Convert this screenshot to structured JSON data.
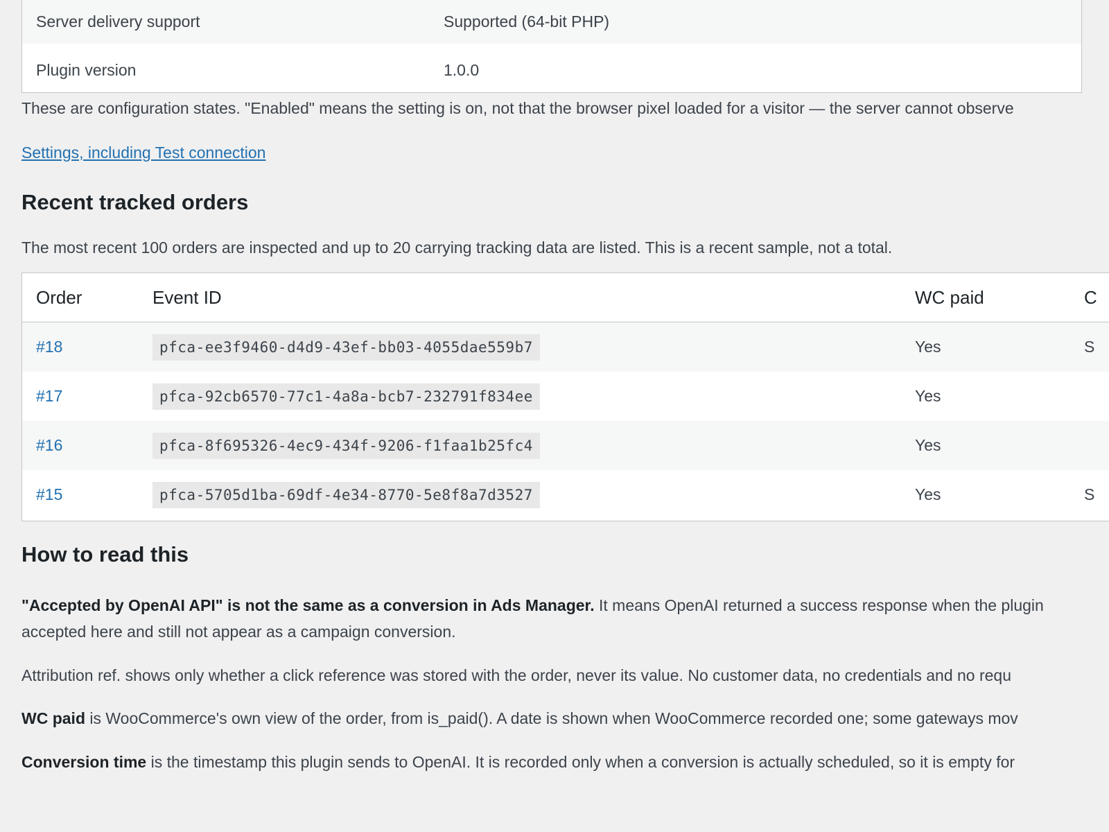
{
  "status_table": {
    "rows": [
      {
        "label": "Server delivery support",
        "value": "Supported (64-bit PHP)"
      },
      {
        "label": "Plugin version",
        "value": "1.0.0"
      }
    ]
  },
  "config_note": "These are configuration states. \"Enabled\" means the setting is on, not that the browser pixel loaded for a visitor — the server cannot observe",
  "settings_link": "Settings, including Test connection",
  "recent_orders": {
    "heading": "Recent tracked orders",
    "description": "The most recent 100 orders are inspected and up to 20 carrying tracking data are listed. This is a recent sample, not a total.",
    "columns": {
      "order": "Order",
      "event_id": "Event ID",
      "wc_paid": "WC paid",
      "next": "C"
    },
    "rows": [
      {
        "order": "#18",
        "event_id": "pfca-ee3f9460-d4d9-43ef-bb03-4055dae559b7",
        "wc_paid": "Yes",
        "next": "S"
      },
      {
        "order": "#17",
        "event_id": "pfca-92cb6570-77c1-4a8a-bcb7-232791f834ee",
        "wc_paid": "Yes",
        "next": ""
      },
      {
        "order": "#16",
        "event_id": "pfca-8f695326-4ec9-434f-9206-f1faa1b25fc4",
        "wc_paid": "Yes",
        "next": ""
      },
      {
        "order": "#15",
        "event_id": "pfca-5705d1ba-69df-4e34-8770-5e8f8a7d3527",
        "wc_paid": "Yes",
        "next": "S"
      }
    ]
  },
  "how_to_read": {
    "heading": "How to read this",
    "p1_bold": "\"Accepted by OpenAI API\" is not the same as a conversion in Ads Manager.",
    "p1_rest": " It means OpenAI returned a success response when the plugin",
    "p1_line2": "accepted here and still not appear as a campaign conversion.",
    "p2": "Attribution ref. shows only whether a click reference was stored with the order, never its value. No customer data, no credentials and no requ",
    "p3_bold": "WC paid",
    "p3_rest": " is WooCommerce's own view of the order, from is_paid(). A date is shown when WooCommerce recorded one; some gateways mov",
    "p4_bold": "Conversion time",
    "p4_rest": " is the timestamp this plugin sends to OpenAI. It is recorded only when a conversion is actually scheduled, so it is empty for"
  }
}
